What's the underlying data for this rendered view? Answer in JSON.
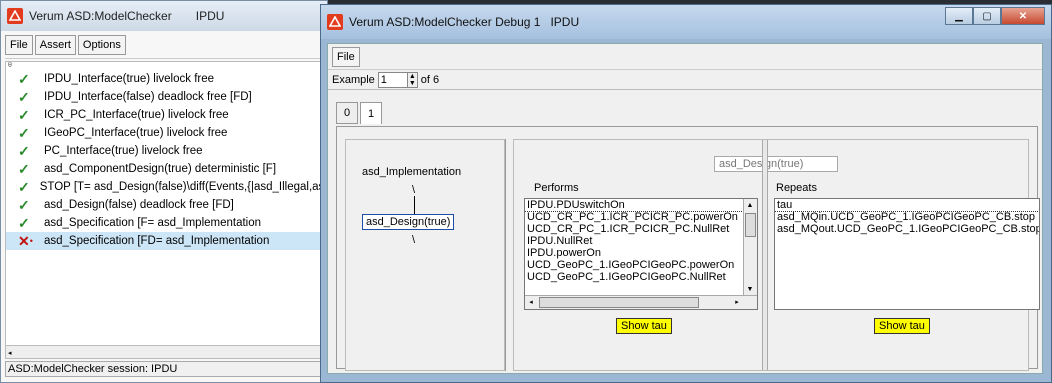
{
  "back_window": {
    "title": "Verum ASD:ModelChecker",
    "title_suffix": "IPDU",
    "menu": [
      "File",
      "Assert",
      "Options"
    ],
    "marker": "θ",
    "items": [
      {
        "status": "check",
        "label": "IPDU_Interface(true) livelock free"
      },
      {
        "status": "check",
        "label": "IPDU_Interface(false) deadlock free [FD]"
      },
      {
        "status": "check",
        "label": "ICR_PC_Interface(true) livelock free"
      },
      {
        "status": "check",
        "label": "IGeoPC_Interface(true) livelock free"
      },
      {
        "status": "check",
        "label": "PC_Interface(true) livelock free"
      },
      {
        "status": "check",
        "label": "asd_ComponentDesign(true) deterministic [F]"
      },
      {
        "status": "check",
        "label": "STOP [T= asd_Design(false)\\diff(Events,{|asd_Illegal,asd_"
      },
      {
        "status": "check",
        "label": "asd_Design(false) deadlock free [FD]"
      },
      {
        "status": "check",
        "label": "asd_Specification [F= asd_Implementation"
      },
      {
        "status": "cross",
        "label": "asd_Specification [FD= asd_Implementation",
        "selected": true
      }
    ],
    "status": "ASD:ModelChecker session: IPDU"
  },
  "front_window": {
    "title": "Verum ASD:ModelChecker Debug 1",
    "title_suffix": "IPDU",
    "menu_file": "File",
    "example_label": "Example",
    "example_value": "1",
    "example_of": "of 6",
    "tabs": [
      "0",
      "1"
    ],
    "left_pane": {
      "node_top": "asd_Implementation",
      "slash1": "\\",
      "node_box": "asd_Design(true)",
      "slash2": "\\"
    },
    "right_pane": {
      "state_box": "asd_Design(true)",
      "performs_label": "Performs",
      "performs": [
        "IPDU.PDUswitchOn",
        "UCD_CR_PC_1.ICR_PCICR_PC.powerOn",
        "UCD_CR_PC_1.ICR_PCICR_PC.NullRet",
        "IPDU.NullRet",
        "IPDU.powerOn",
        "UCD_GeoPC_1.IGeoPCIGeoPC.powerOn",
        "UCD_GeoPC_1.IGeoPCIGeoPC.NullRet"
      ],
      "repeats_label": "Repeats",
      "repeats": [
        "tau",
        "asd_MQin.UCD_GeoPC_1.IGeoPCIGeoPC_CB.stop",
        "asd_MQout.UCD_GeoPC_1.IGeoPCIGeoPC_CB.stop"
      ],
      "show_tau_1": "Show tau",
      "show_tau_2": "Show tau"
    }
  },
  "colors": {
    "title_bar": "#cdd9e6",
    "accent_red": "#e23b1e",
    "show_tau_bg": "#ffff00",
    "selection": "#cde6f7"
  }
}
